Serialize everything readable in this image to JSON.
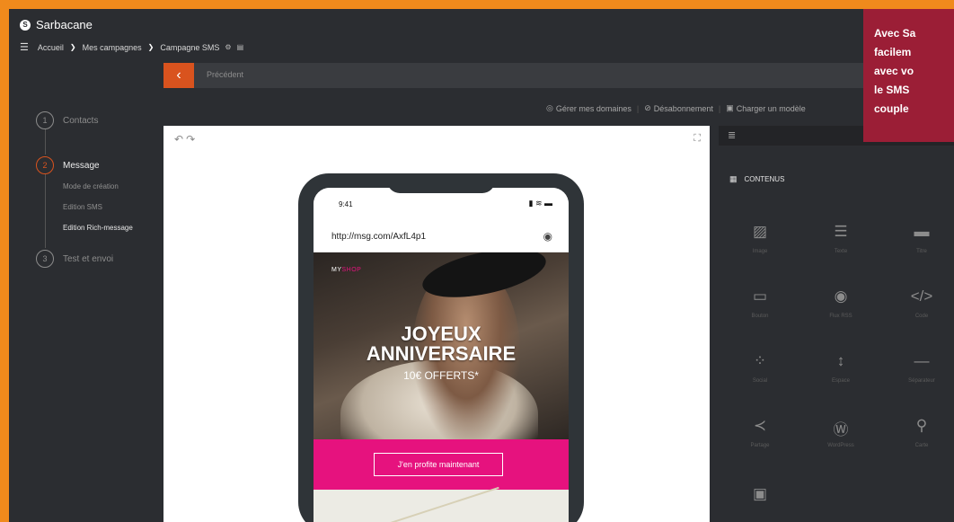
{
  "app": {
    "name": "Sarbacane"
  },
  "breadcrumb": {
    "items": [
      "Accueil",
      "Mes campagnes",
      "Campagne SMS"
    ]
  },
  "nav": {
    "prev_label": "Précédent"
  },
  "steps": [
    {
      "num": "1",
      "label": "Contacts"
    },
    {
      "num": "2",
      "label": "Message"
    },
    {
      "num": "3",
      "label": "Test et envoi"
    }
  ],
  "substeps": [
    "Mode de création",
    "Edition SMS",
    "Edition Rich-message"
  ],
  "actions": {
    "domains": "Gérer mes domaines",
    "unsubscribe": "Désabonnement",
    "load_model": "Charger un modèle"
  },
  "phone": {
    "time": "9:41",
    "url": "http://msg.com/AxfL4p1",
    "shop_my": "MY",
    "shop_name": "SHOP",
    "headline_1": "JOYEUX",
    "headline_2": "ANNIVERSAIRE",
    "offer": "10€ OFFERTS*",
    "cta": "J'en profite maintenant"
  },
  "panel": {
    "title": "CONTENUS",
    "tiles": [
      {
        "icon": "image-icon",
        "glyph": "▨",
        "label": "Image"
      },
      {
        "icon": "text-icon",
        "glyph": "☰",
        "label": "Texte"
      },
      {
        "icon": "title-icon",
        "glyph": "▬",
        "label": "Titre"
      },
      {
        "icon": "button-icon",
        "glyph": "▭",
        "label": "Bouton"
      },
      {
        "icon": "rss-icon",
        "glyph": "◉",
        "label": "Flux RSS"
      },
      {
        "icon": "code-icon",
        "glyph": "</>",
        "label": "Code"
      },
      {
        "icon": "social-icon",
        "glyph": "⁘",
        "label": "Social"
      },
      {
        "icon": "spacer-icon",
        "glyph": "↕",
        "label": "Espace"
      },
      {
        "icon": "separator-icon",
        "glyph": "—",
        "label": "Séparateur"
      },
      {
        "icon": "share-icon",
        "glyph": "≺",
        "label": "Partage"
      },
      {
        "icon": "wordpress-icon",
        "glyph": "Ⓦ",
        "label": "WordPress"
      },
      {
        "icon": "map-pin-icon",
        "glyph": "⚲",
        "label": "Carte"
      },
      {
        "icon": "video-icon",
        "glyph": "▣",
        "label": ""
      }
    ]
  },
  "promo": {
    "lines": [
      "Avec Sa",
      "facilem",
      "avec vo",
      "le SMS",
      "couple"
    ]
  },
  "colors": {
    "accent": "#d9531e",
    "pink": "#e6127e",
    "promo": "#9b1e36",
    "frame": "#f08a1c"
  }
}
